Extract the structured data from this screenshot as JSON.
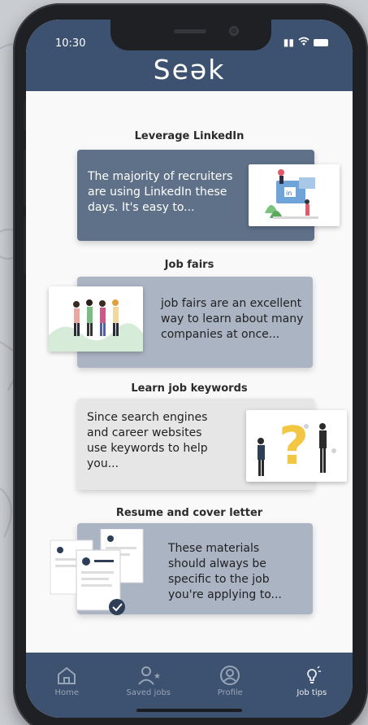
{
  "status_bar": {
    "time": "10:30"
  },
  "app": {
    "logo": "Seək"
  },
  "tips": [
    {
      "title": "Leverage LinkedIn",
      "text": "The majority of recruiters are using LinkedIn these days. It's easy to..."
    },
    {
      "title": "Job fairs",
      "text": "job fairs are an excellent way to learn about many companies at once..."
    },
    {
      "title": "Learn job keywords",
      "text": "Since search engines and career websites use keywords to help you..."
    },
    {
      "title": "Resume and cover letter",
      "text": "These materials should always be specific to the job you're applying to..."
    }
  ],
  "nav": {
    "items": [
      {
        "label": "Home",
        "icon": "home-icon"
      },
      {
        "label": "Saved jobs",
        "icon": "saved-user-icon"
      },
      {
        "label": "Profile",
        "icon": "profile-icon"
      },
      {
        "label": "Job tips",
        "icon": "lightbulb-icon"
      }
    ],
    "active": "Job tips"
  },
  "colors": {
    "header": "#3d5270",
    "card_dark": "#5f7189",
    "card_light": "#aab4c3",
    "card_lighter": "#e6e6e6"
  }
}
